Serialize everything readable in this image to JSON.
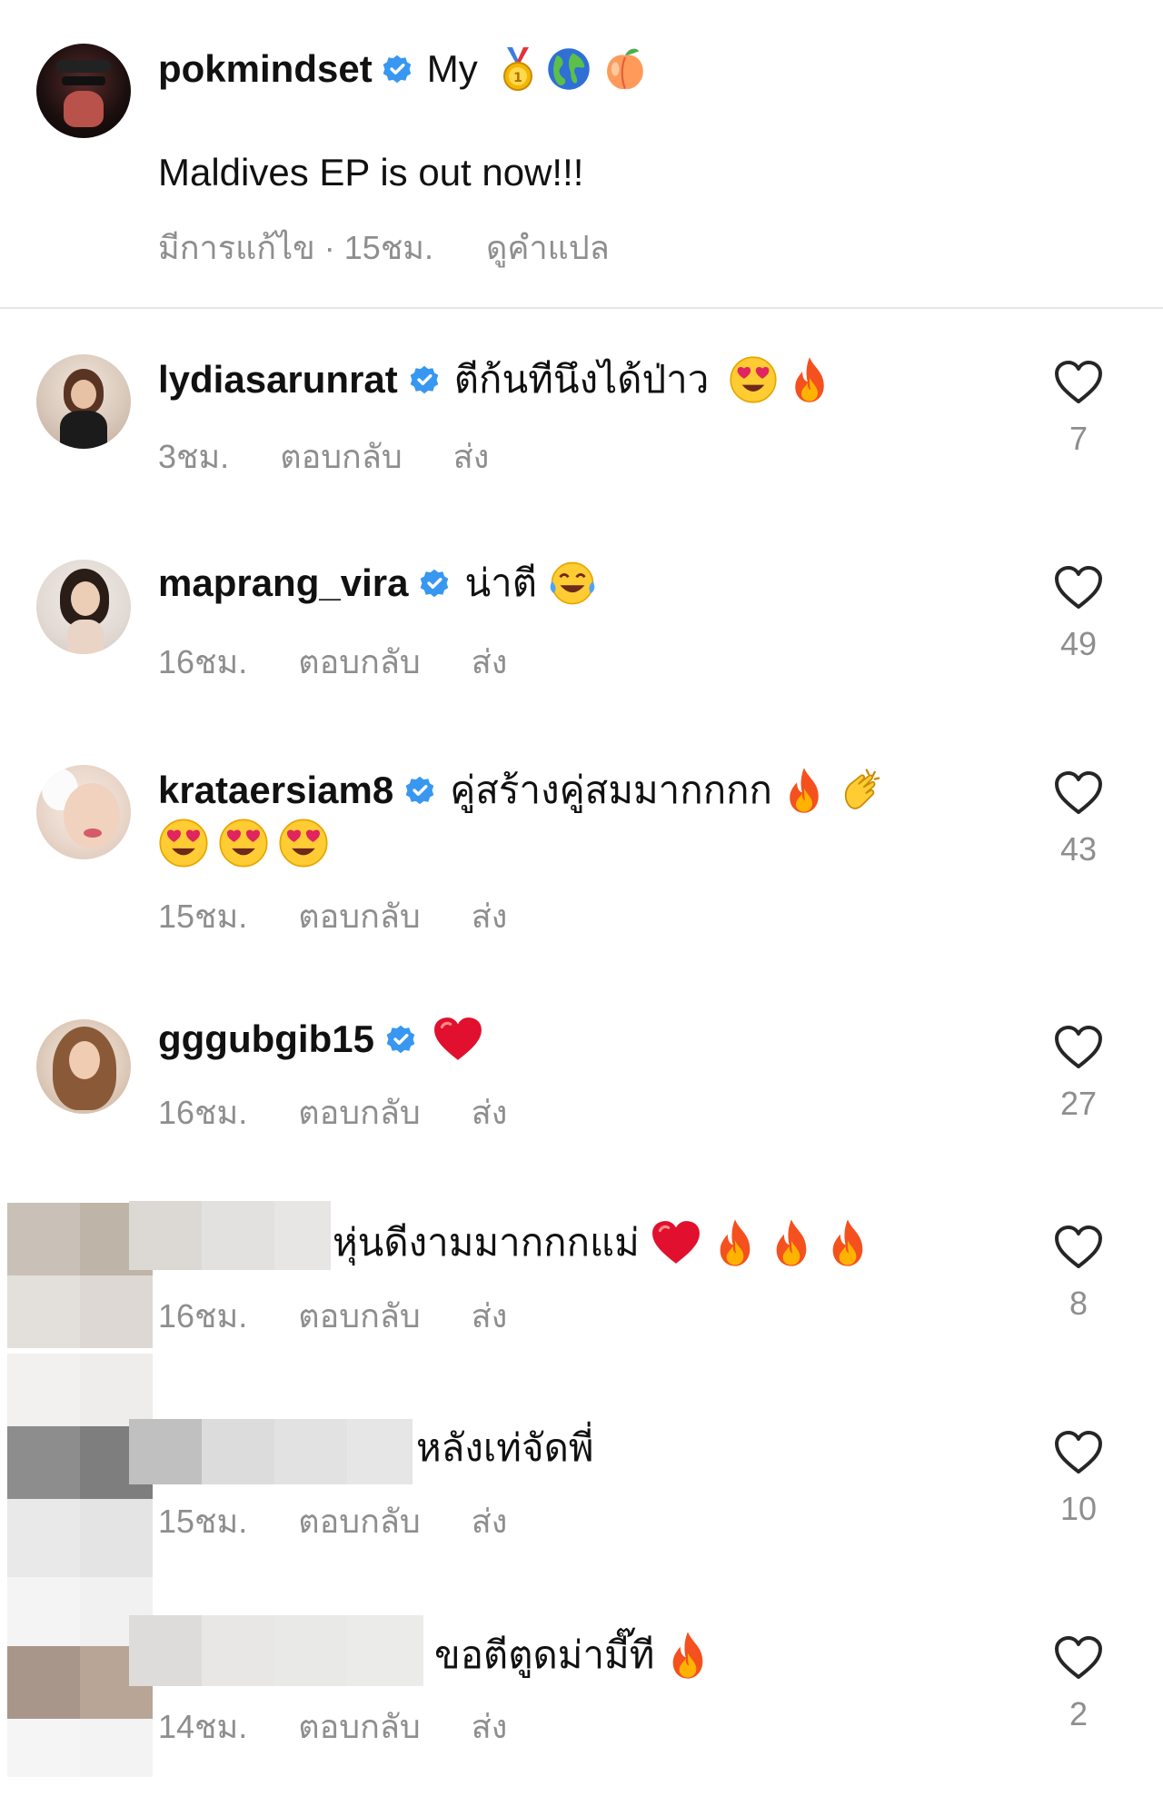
{
  "post": {
    "username": "pokmindset",
    "bio_prefix": "My",
    "bio_icons": [
      "medal-icon",
      "globe-icon",
      "peach-icon"
    ],
    "caption": "Maldives EP is out now!!!",
    "edited_time": "มีการแก้ไข · 15ชม.",
    "see_translation": "ดูคำแปล"
  },
  "labels": {
    "reply": "ตอบกลับ",
    "send": "ส่ง"
  },
  "comments": [
    {
      "username": "lydiasarunrat",
      "verified": true,
      "text": "ตีก้นทีนึงได้ป่าว",
      "emojis": [
        "heart-eyes-icon",
        "fire-icon"
      ],
      "time": "3ชม.",
      "likes": "7"
    },
    {
      "username": "maprang_vira",
      "verified": true,
      "text": "น่าตี",
      "emojis": [
        "laughing-tears-icon"
      ],
      "time": "16ชม.",
      "likes": "49"
    },
    {
      "username": "krataersiam8",
      "verified": true,
      "text": "คู่สร้างคู่สมมากกกก",
      "emojis": [
        "fire-icon",
        "clapping-hands-icon",
        "heart-eyes-icon",
        "heart-eyes-icon",
        "heart-eyes-icon"
      ],
      "time": "15ชม.",
      "likes": "43"
    },
    {
      "username": "gggubgib15",
      "verified": true,
      "text": "",
      "emojis": [
        "red-heart-icon"
      ],
      "time": "16ชม.",
      "likes": "27"
    },
    {
      "username": "",
      "verified": false,
      "text": "หุ่นดีงามมากกกแม่",
      "emojis": [
        "red-heart-icon",
        "fire-icon",
        "fire-icon",
        "fire-icon"
      ],
      "time": "16ชม.",
      "likes": "8"
    },
    {
      "username": "",
      "verified": false,
      "text": "หลังเท่จัดพี่",
      "emojis": [],
      "time": "15ชม.",
      "likes": "10"
    },
    {
      "username": "",
      "verified": false,
      "text": "ขอตีตูดม่ามี๊ที",
      "emojis": [
        "fire-icon"
      ],
      "time": "14ชม.",
      "likes": "2"
    }
  ],
  "colors": {
    "verified_blue": "#3897f0",
    "meta_gray": "#8e8e8e",
    "heart_red": "#e0245e"
  }
}
